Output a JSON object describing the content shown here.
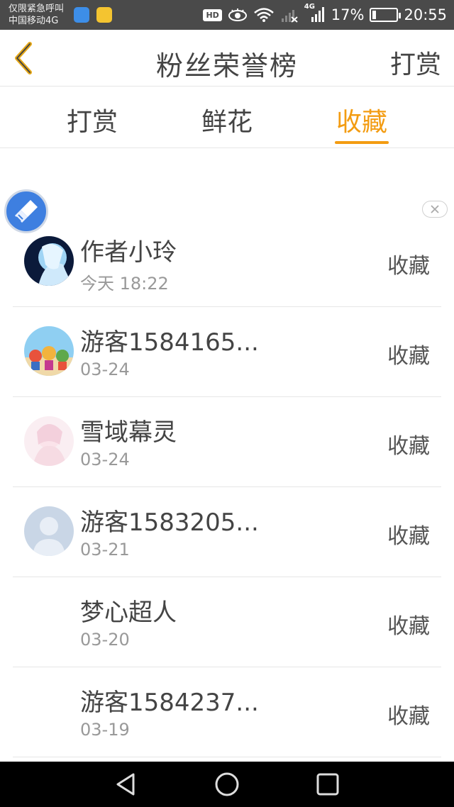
{
  "status_bar": {
    "line1": "仅限紧急呼叫",
    "line2": "中国移动4G",
    "hd": "HD",
    "network": "4G",
    "battery": "17%",
    "time": "20:55",
    "battery_level": 0.17
  },
  "header": {
    "back_icon": "chevron-left-icon",
    "title": "粉丝荣誉榜",
    "action": "打赏"
  },
  "tabs": {
    "items": [
      "打赏",
      "鲜花",
      "收藏"
    ],
    "active_index": 2,
    "active_color": "#f39c12"
  },
  "list": {
    "rows": [
      {
        "name": "作者小玲",
        "date": "今天 18:22",
        "action": "收藏"
      },
      {
        "name": "游客1584165...",
        "date": "03-24",
        "action": "收藏"
      },
      {
        "name": "雪域幕灵",
        "date": "03-24",
        "action": "收藏"
      },
      {
        "name": "游客1583205...",
        "date": "03-21",
        "action": "收藏"
      },
      {
        "name": "梦心超人",
        "date": "03-20",
        "action": "收藏"
      },
      {
        "name": "游客1584237...",
        "date": "03-19",
        "action": "收藏"
      }
    ]
  },
  "navbar": {
    "back_icon": "triangle-back-icon",
    "home_icon": "circle-home-icon",
    "recents_icon": "square-recents-icon"
  }
}
